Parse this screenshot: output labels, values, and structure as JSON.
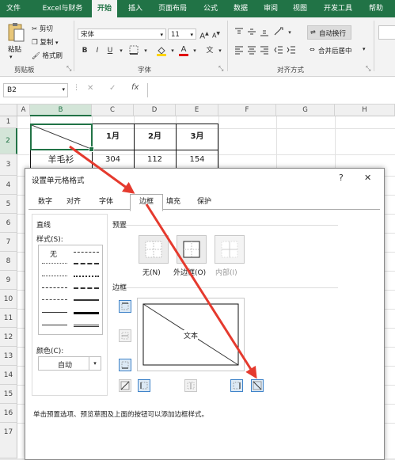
{
  "ribbon_tabs": [
    "文件",
    "Excel与财务",
    "开始",
    "插入",
    "页面布局",
    "公式",
    "数据",
    "审阅",
    "视图",
    "开发工具",
    "帮助"
  ],
  "active_tab": "开始",
  "clipboard": {
    "paste": "粘贴",
    "cut": "剪切",
    "copy": "复制",
    "format_painter": "格式刷",
    "group": "剪贴板"
  },
  "font": {
    "name": "宋体",
    "size": "11",
    "grow": "A",
    "shrink": "A",
    "bold": "B",
    "italic": "I",
    "underline": "U",
    "group": "字体",
    "wen": "文"
  },
  "alignment": {
    "wrap": "自动换行",
    "merge": "合并后居中",
    "group": "对齐方式"
  },
  "formula_bar": {
    "name_box": "B2",
    "cancel": "✕",
    "enter": "✓",
    "fx": "fx"
  },
  "grid": {
    "columns": [
      "A",
      "B",
      "C",
      "D",
      "E",
      "F",
      "G",
      "H"
    ],
    "rows": [
      "1",
      "2",
      "3",
      "4",
      "5",
      "6",
      "7",
      "8",
      "9",
      "10",
      "11",
      "12",
      "13",
      "14",
      "15",
      "16",
      "17"
    ],
    "cells": {
      "C2": "1月",
      "D2": "2月",
      "E2": "3月",
      "B3": "羊毛衫",
      "C3": "304",
      "D3": "112",
      "E3": "154"
    }
  },
  "dialog": {
    "title": "设置单元格格式",
    "help": "?",
    "close": "✕",
    "tabs": [
      "数字",
      "对齐",
      "字体",
      "边框",
      "填充",
      "保护"
    ],
    "active_tab": "边框",
    "line_group": "直线",
    "style_label": "样式(S):",
    "none_style": "无",
    "color_label": "颜色(C):",
    "color_value": "自动",
    "presets_label": "预置",
    "presets": [
      "无(N)",
      "外边框(O)",
      "内部(I)"
    ],
    "border_label": "边框",
    "preview_text": "文本",
    "hint": "单击预置选项、预览草图及上面的按钮可以添加边框样式。"
  },
  "colors": {
    "excel_green": "#217346",
    "arrow_red": "#e53a2e",
    "selection_green": "#217346"
  }
}
